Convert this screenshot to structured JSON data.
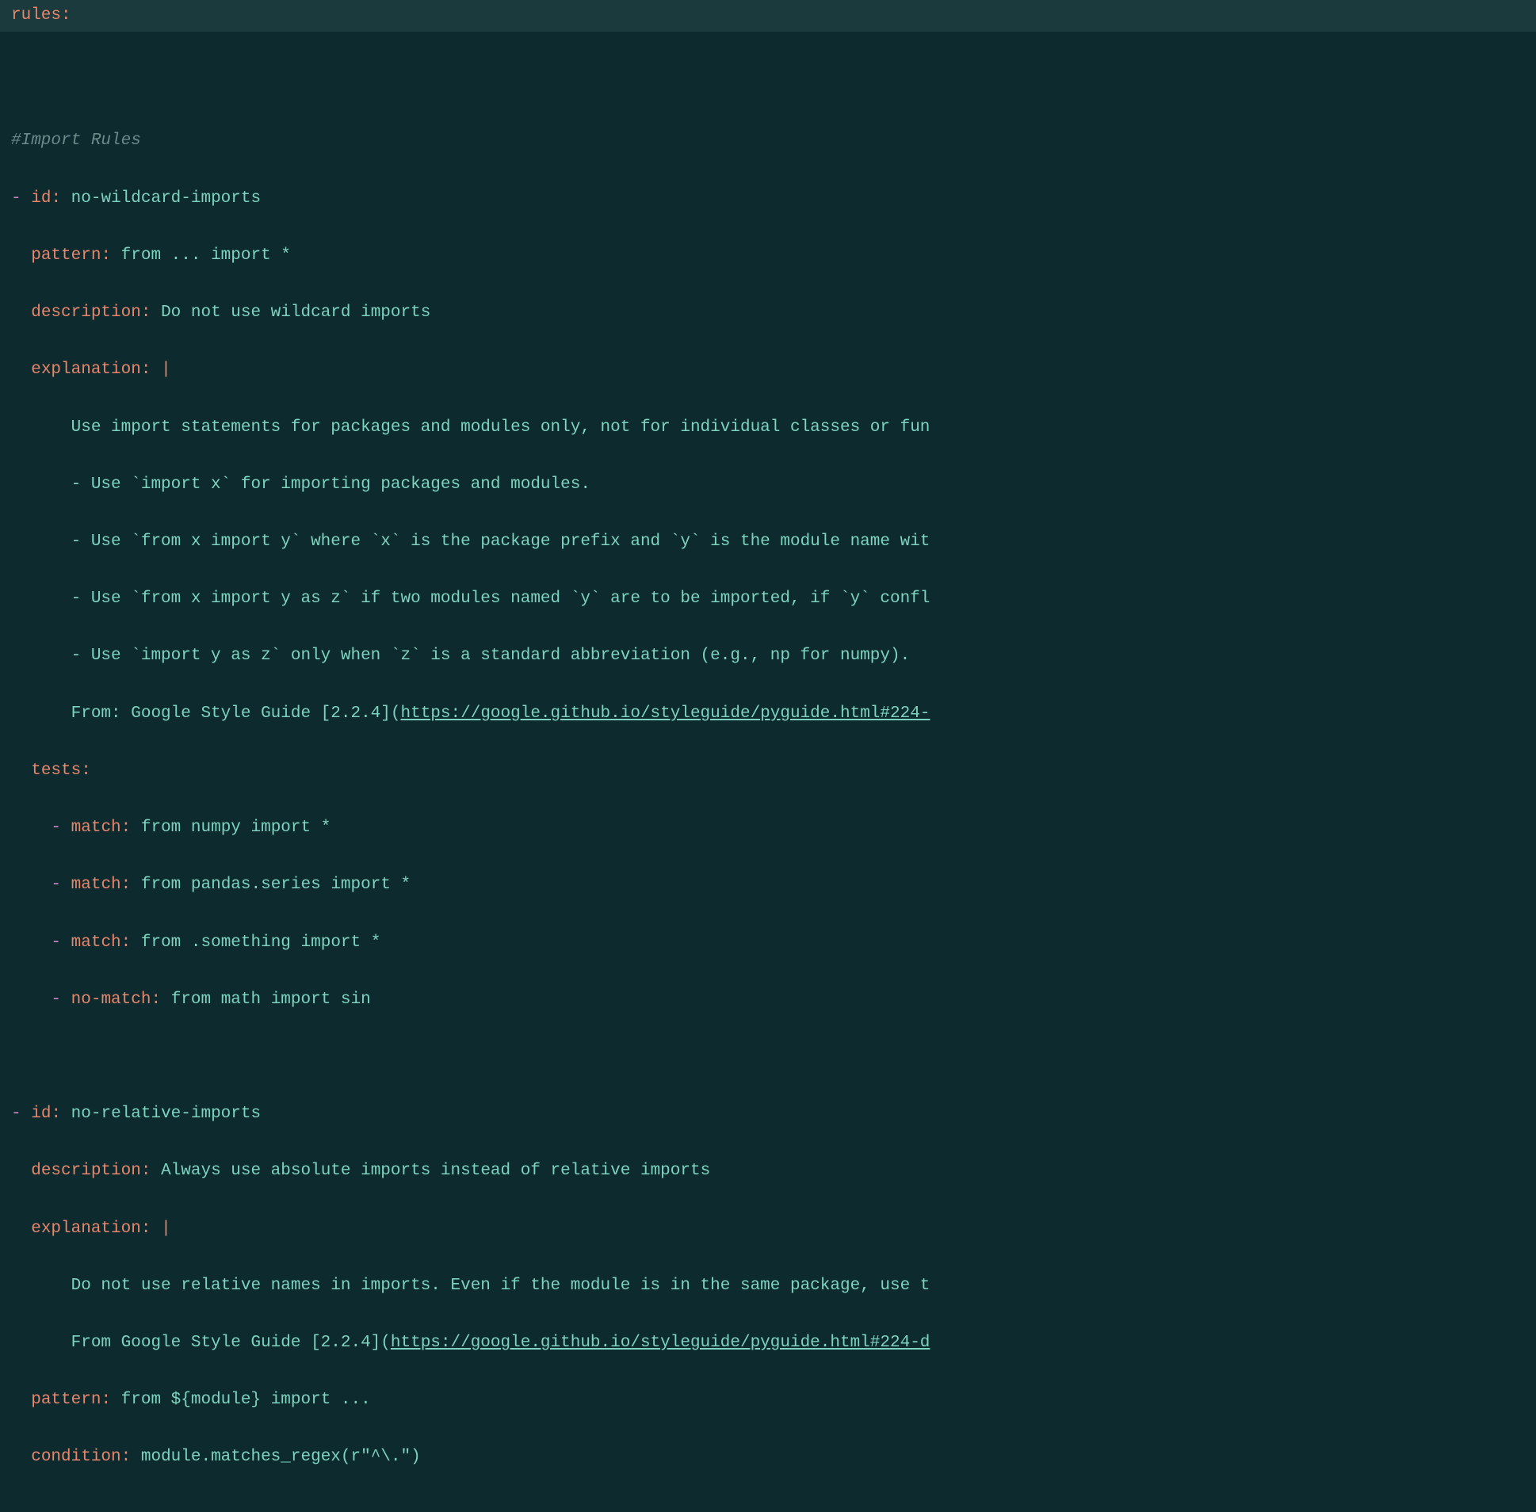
{
  "topKey": "rules",
  "commentImport": "#Import Rules",
  "rule1": {
    "dash": "-",
    "idKey": "id",
    "idVal": "no-wildcard-imports",
    "patternKey": "pattern",
    "patternVal": "from ... import *",
    "descKey": "description",
    "descVal": "Do not use wildcard imports",
    "explKey": "explanation",
    "pipe": "|",
    "expl1": "Use import statements for packages and modules only, not for individual classes or fun",
    "expl2": "- Use `import x` for importing packages and modules.",
    "expl3": "- Use `from x import y` where `x` is the package prefix and `y` is the module name wit",
    "expl4": "- Use `from x import y as z` if two modules named `y` are to be imported, if `y` confl",
    "expl5": "- Use `import y as z` only when `z` is a standard abbreviation (e.g., np for numpy).",
    "expl6a": "From: Google Style Guide [2.2.4](",
    "expl6link": "https://google.github.io/styleguide/pyguide.html#224-",
    "testsKey": "tests",
    "matchKey": "match",
    "noMatchKey": "no-match",
    "test1": "from numpy import *",
    "test2": "from pandas.series import *",
    "test3": "from .something import *",
    "test4": "from math import sin"
  },
  "rule2": {
    "dash": "-",
    "idKey": "id",
    "idVal": "no-relative-imports",
    "descKey": "description",
    "descVal": "Always use absolute imports instead of relative imports",
    "explKey": "explanation",
    "pipe": "|",
    "expl1": "Do not use relative names in imports. Even if the module is in the same package, use t",
    "expl2a": "From Google Style Guide [2.2.4](",
    "expl2link": "https://google.github.io/styleguide/pyguide.html#224-d",
    "patternKey": "pattern",
    "patternVal": "from ${module} import ...",
    "conditionKey": "condition",
    "conditionVal": "module.matches_regex(r\"^\\.\")"
  }
}
